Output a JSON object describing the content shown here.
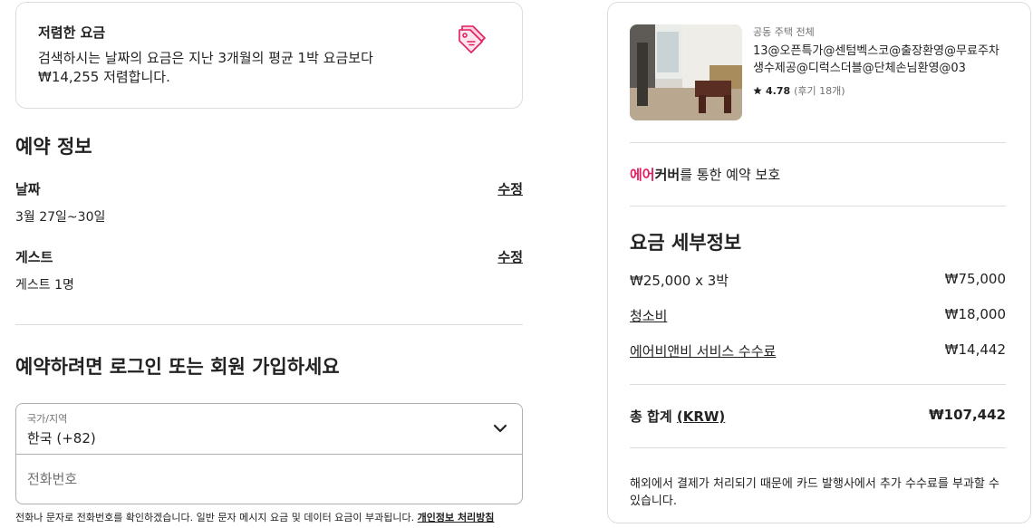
{
  "promo": {
    "title": "저렴한 요금",
    "text": "검색하시는 날짜의 요금은 지난 3개월의 평균 1박 요금보다 ₩14,255 저렴합니다.",
    "icon": "price-tag-icon",
    "icon_color": "#e31c5f"
  },
  "booking": {
    "title": "예약 정보",
    "dates_label": "날짜",
    "dates_value": "3월 27일~30일",
    "guests_label": "게스트",
    "guests_value": "게스트 1명",
    "edit_label": "수정"
  },
  "login": {
    "title": "예약하려면 로그인 또는 회원 가입하세요",
    "country_label": "국가/지역",
    "country_value": "한국 (+82)",
    "phone_placeholder": "전화번호",
    "disclaimer": "전화나 문자로 전화번호를 확인하겠습니다. 일반 문자 메시지 요금 및 데이터 요금이 부과됩니다.",
    "privacy_link": "개인정보 처리방침"
  },
  "listing": {
    "type": "공동 주택 전체",
    "name": "13@오픈특가@센텀벡스코@출장환영@무료주차 생수제공@디럭스더블@단체손님환영@03",
    "rating": "4.78",
    "reviews": "(후기 18개)"
  },
  "aircover": {
    "air": "에어",
    "cover": "커버",
    "rest": "를 통한 예약 보호"
  },
  "price": {
    "title": "요금 세부정보",
    "rows": [
      {
        "label": "₩25,000 x 3박",
        "value": "₩75,000"
      },
      {
        "label": "청소비",
        "value": "₩18,000"
      },
      {
        "label": "에어비앤비 서비스 수수료",
        "value": "₩14,442"
      }
    ],
    "total_label": "총 합계",
    "total_currency": "(KRW)",
    "total_value": "₩107,442",
    "footnote": "해외에서 결제가 처리되기 때문에 카드 발행사에서 추가 수수료를 부과할 수 있습니다."
  },
  "colors": {
    "accent": "#e31c5f",
    "border": "#dddddd"
  }
}
